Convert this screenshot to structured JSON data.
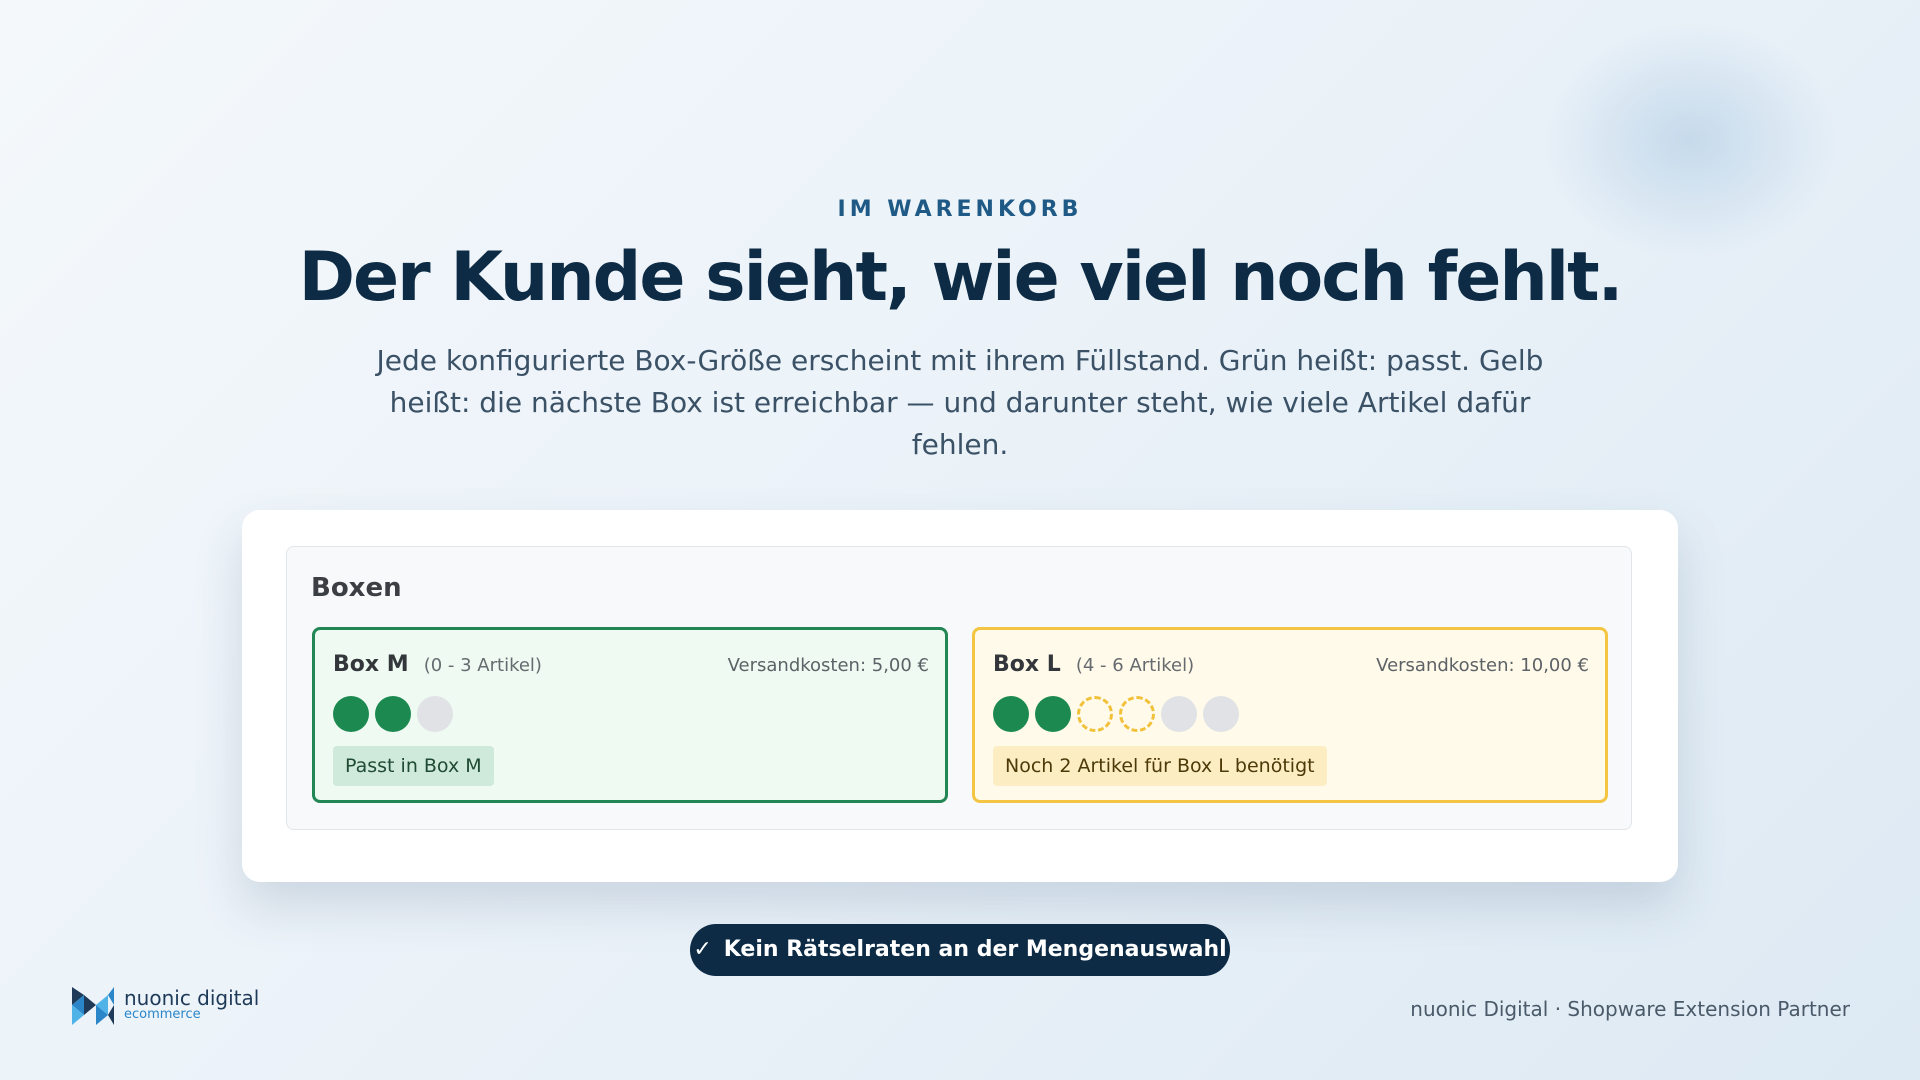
{
  "eyebrow": "IM WARENKORB",
  "headline": "Der Kunde sieht, wie viel noch fehlt.",
  "subtitle": "Jede konfigurierte Box-Größe erscheint mit ihrem Füllstand. Grün heißt: passt. Gelb heißt: die nächste Box ist erreichbar — und darunter steht, wie viele Artikel dafür fehlen.",
  "panel": {
    "title": "Boxen",
    "boxes": [
      {
        "name": "Box M",
        "range": "(0 - 3 Artikel)",
        "cost": "Versandkosten: 5,00 €",
        "status": "fits",
        "capacity": 3,
        "filled": 2,
        "missing": 0,
        "badge": "Passt in Box M",
        "color": "#238655"
      },
      {
        "name": "Box L",
        "range": "(4 - 6 Artikel)",
        "cost": "Versandkosten: 10,00 €",
        "status": "reachable",
        "capacity": 6,
        "filled": 2,
        "missing": 2,
        "badge": "Noch 2 Artikel für Box L benötigt",
        "color": "#f4c542"
      }
    ]
  },
  "pill": {
    "icon": "check-icon",
    "label": "Kein Rätselraten an der Mengenauswahl"
  },
  "logo": {
    "name": "nuonic digital",
    "sub": "ecommerce"
  },
  "footer": "nuonic Digital · Shopware Extension Partner",
  "colors": {
    "navy": "#0d2b45",
    "green": "#1c8a50",
    "yellow": "#f2c13a",
    "eyebrow": "#1f5a86"
  }
}
